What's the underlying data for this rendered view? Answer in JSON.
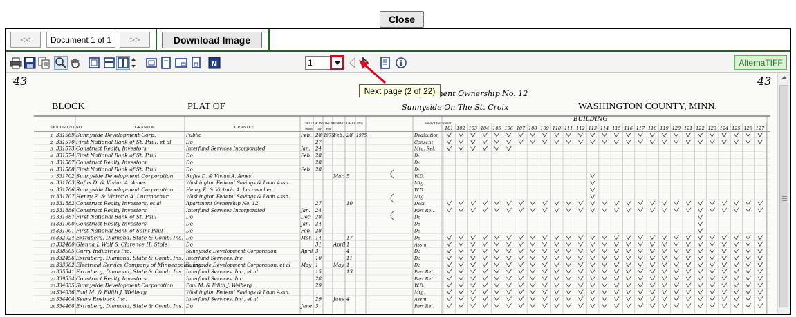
{
  "top": {
    "close_label": "Close"
  },
  "nav": {
    "prev_label": "<<",
    "next_label": ">>",
    "doc_count": "Document 1 of 1",
    "download_label": "Download Image"
  },
  "toolbar": {
    "page_value": "1",
    "brand_label": "AlternaTIFF",
    "icons": [
      "print-icon",
      "save-icon",
      "copy-icon",
      "zoom-icon",
      "pan-hand-icon",
      "fit-page-icon",
      "fit-width-icon",
      "fit-height-icon",
      "zoom-stepper-icon",
      "single-page-icon",
      "page-icon",
      "thumbnail-icon",
      "multi-page-icon",
      "invert-icon",
      "page-dropdown-icon",
      "previous-page-icon",
      "next-page-icon",
      "properties-icon",
      "info-icon"
    ]
  },
  "tooltip": {
    "text": "Next page (2 of 22)"
  },
  "annotation": {
    "color": "#e3001b"
  },
  "document": {
    "page_num_left": "43",
    "page_num_right": "43",
    "block_label": "BLOCK",
    "plat_label": "PLAT OF",
    "location_label": "WASHINGTON COUNTY, MINN.",
    "handwritten_title_1": "Apartment Ownership No. 12",
    "handwritten_title_2": "Sunnyside On The St. Croix",
    "col_document_no": "DOCUMENT NO.",
    "col_grantor": "GRANTOR",
    "col_grantee": "GRANTEE",
    "col_date_instrument": "DATE OF INSTRUMENT",
    "col_date_filing": "DATE OF FILING",
    "col_kind": "Kind of Instrument",
    "col_building": "BUILDING",
    "sub_month": "Month",
    "sub_day": "Day",
    "sub_year": "Year",
    "unit_numbers": [
      "101",
      "102",
      "103",
      "104",
      "105",
      "106",
      "107",
      "108",
      "109",
      "110",
      "111",
      "112",
      "113",
      "114",
      "115",
      "116",
      "117",
      "118",
      "119",
      "120",
      "121",
      "122",
      "123",
      "124",
      "125",
      "126",
      "127"
    ],
    "rows": [
      {
        "doc": "331569",
        "grantor": "Sunnyside Development Corp.",
        "grantee": "Public",
        "month": "Feb.",
        "day": "28",
        "year": "1975",
        "fmonth": "Feb.",
        "fday": "28",
        "fyear": "1975",
        "kind": "Dedication"
      },
      {
        "doc": "331570",
        "grantor": "First National Bank of St. Paul, et al",
        "grantee": "Do",
        "month": "",
        "day": "27",
        "year": "",
        "fmonth": "",
        "fday": "",
        "fyear": "",
        "kind": "Consent"
      },
      {
        "doc": "331573",
        "grantor": "Construct Realty Investors",
        "grantee": "Interfund Services Incorporated",
        "month": "Jan.",
        "day": "24",
        "year": "",
        "fmonth": "",
        "fday": "",
        "fyear": "",
        "kind": "Mtg. Rel."
      },
      {
        "doc": "331574",
        "grantor": "First National Bank of St. Paul",
        "grantee": "Do",
        "month": "Feb.",
        "day": "28",
        "year": "",
        "fmonth": "",
        "fday": "",
        "fyear": "",
        "kind": "Do"
      },
      {
        "doc": "331587",
        "grantor": "Construct Realty Investors",
        "grantee": "Do",
        "month": "",
        "day": "28",
        "year": "",
        "fmonth": "",
        "fday": "",
        "fyear": "",
        "kind": "Do"
      },
      {
        "doc": "331588",
        "grantor": "First National Bank of St. Paul",
        "grantee": "Do",
        "month": "Feb.",
        "day": "28",
        "year": "",
        "fmonth": "",
        "fday": "",
        "fyear": "",
        "kind": "Do"
      },
      {
        "doc": "331702",
        "grantor": "Sunnyside Development Corporation",
        "grantee": "Rufus D. & Vivian A. Ames",
        "month": "",
        "day": "",
        "year": "",
        "fmonth": "Mar.",
        "fday": "5",
        "fyear": "",
        "kind": "W.D."
      },
      {
        "doc": "331703",
        "grantor": "Rufus D. & Vivian A. Ames",
        "grantee": "Washington Federal Savings & Loan Assn.",
        "month": "",
        "day": "",
        "year": "",
        "fmonth": "",
        "fday": "",
        "fyear": "",
        "kind": "Mtg."
      },
      {
        "doc": "331706",
        "grantor": "Sunnyside Development Corporation",
        "grantee": "Henry E. & Victoria A. Lutzmacher",
        "month": "",
        "day": "",
        "year": "",
        "fmonth": "",
        "fday": "",
        "fyear": "",
        "kind": "W.D."
      },
      {
        "doc": "331707",
        "grantor": "Henry E. & Victoria A. Lutzmacher",
        "grantee": "Washington Federal Savings & Loan Assn.",
        "month": "",
        "day": "",
        "year": "",
        "fmonth": "",
        "fday": "",
        "fyear": "",
        "kind": "Mtg."
      },
      {
        "doc": "331882",
        "grantor": "Construct Realty Investors, et al",
        "grantee": "Apartment Ownership No. 12",
        "month": "",
        "day": "27",
        "year": "",
        "fmonth": "",
        "fday": "10",
        "fyear": "",
        "kind": "Decl."
      },
      {
        "doc": "331886",
        "grantor": "Construct Realty Investors",
        "grantee": "Interfund Services Incorporated",
        "month": "Jan.",
        "day": "24",
        "year": "",
        "fmonth": "",
        "fday": "",
        "fyear": "",
        "kind": "Part Rel."
      },
      {
        "doc": "331887",
        "grantor": "First National Bank of St. Paul",
        "grantee": "Do",
        "month": "Dec.",
        "day": "28",
        "year": "",
        "fmonth": "",
        "fday": "",
        "fyear": "",
        "kind": "Do"
      },
      {
        "doc": "331900",
        "grantor": "Construct Realty Investors",
        "grantee": "Do",
        "month": "Jan.",
        "day": "24",
        "year": "",
        "fmonth": "",
        "fday": "",
        "fyear": "",
        "kind": "Do"
      },
      {
        "doc": "331901",
        "grantor": "First National Bank of Saint Paul",
        "grantee": "Do",
        "month": "Feb.",
        "day": "28",
        "year": "",
        "fmonth": "",
        "fday": "",
        "fyear": "",
        "kind": "Do"
      },
      {
        "doc": "332024",
        "grantor": "Extraberg, Diamond, State & Comb. Ins.",
        "grantee": "Do",
        "month": "Mar.",
        "day": "14",
        "year": "",
        "fmonth": "",
        "fday": "17",
        "fyear": "",
        "kind": "Do"
      },
      {
        "doc": "332480",
        "grantor": "Glenna J. Wolf & Clarence H. Stole",
        "grantee": "Do",
        "month": "",
        "day": "31",
        "year": "",
        "fmonth": "April",
        "fday": "1",
        "fyear": "",
        "kind": "Assm."
      },
      {
        "doc": "338505",
        "grantor": "Curry Industries Inc.",
        "grantee": "Sunnyside Development Corporation",
        "month": "April",
        "day": "3",
        "year": "",
        "fmonth": "",
        "fday": "4",
        "fyear": "",
        "kind": "Do"
      },
      {
        "doc": "332496",
        "grantor": "Extraberg, Diamond, State & Comb. Ins.",
        "grantee": "Interfund Services, Inc.",
        "month": "",
        "day": "10",
        "year": "",
        "fmonth": "",
        "fday": "11",
        "fyear": "",
        "kind": "Do"
      },
      {
        "doc": "333902",
        "grantor": "Electrical Service Company of Minneapolis, Inc.",
        "grantee": "Sunnyside Development Corporation, et al",
        "month": "May",
        "day": "1",
        "year": "",
        "fmonth": "May",
        "fday": "1",
        "fyear": "",
        "kind": "Do"
      },
      {
        "doc": "335541",
        "grantor": "Extraberg, Diamond, State & Comb. Ins.",
        "grantee": "Interfund Services, Inc., et al",
        "month": "",
        "day": "15",
        "year": "",
        "fmonth": "",
        "fday": "13",
        "fyear": "",
        "kind": "Part Rel."
      },
      {
        "doc": "339534",
        "grantor": "Construct Realty Investors",
        "grantee": "Interfund Services, Inc.",
        "month": "",
        "day": "28",
        "year": "",
        "fmonth": "",
        "fday": "",
        "fyear": "",
        "kind": "Part Rel."
      },
      {
        "doc": "334035",
        "grantor": "Sunnyside Development Corporation",
        "grantee": "Paul M. & Edith J. Weiberg",
        "month": "",
        "day": "29",
        "year": "",
        "fmonth": "",
        "fday": "",
        "fyear": "",
        "kind": "W.D."
      },
      {
        "doc": "334036",
        "grantor": "Paul M. & Edith J. Weiberg",
        "grantee": "Washington Federal Savings & Loan Assn.",
        "month": "",
        "day": "",
        "year": "",
        "fmonth": "",
        "fday": "",
        "fyear": "",
        "kind": "Mtg."
      },
      {
        "doc": "334404",
        "grantor": "Sears Roebuck Inc.",
        "grantee": "Interfund Services, Inc., et al",
        "month": "",
        "day": "29",
        "year": "",
        "fmonth": "June",
        "fday": "4",
        "fyear": "",
        "kind": "Assm."
      },
      {
        "doc": "334468",
        "grantor": "Extraberg, Diamond, State & Comb. Ins.",
        "grantee": "Do",
        "month": "June",
        "day": "3",
        "year": "",
        "fmonth": "",
        "fday": "",
        "fyear": "",
        "kind": "Part Rel."
      }
    ]
  }
}
